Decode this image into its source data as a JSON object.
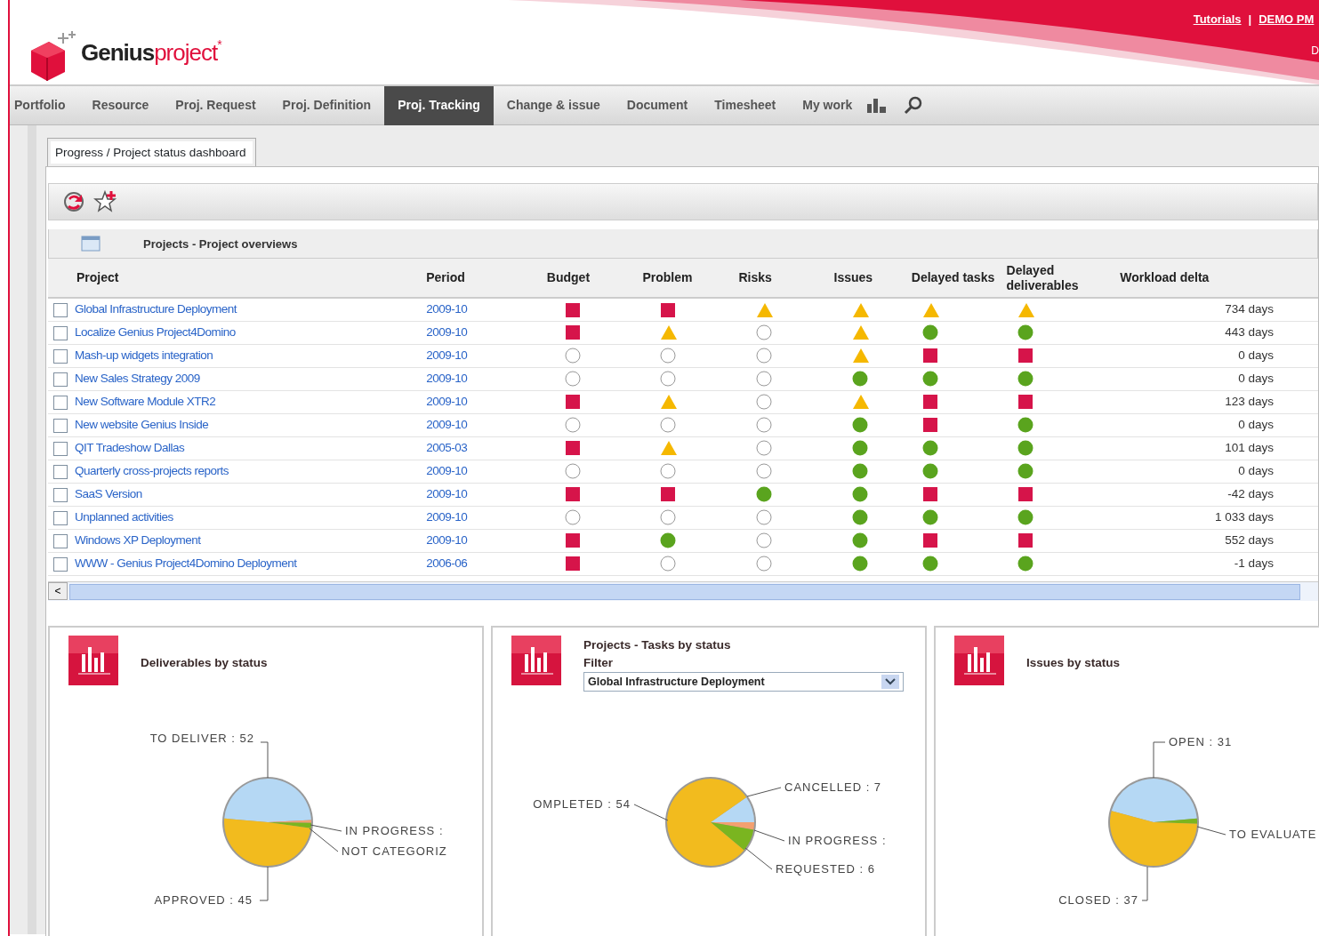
{
  "header": {
    "logo": {
      "brand": "Genius",
      "product": "project",
      "mark": "*"
    },
    "links": [
      {
        "label": "Tutorials"
      },
      {
        "label": "DEMO PM"
      }
    ],
    "separator": "|",
    "user_initial": "D"
  },
  "nav": [
    {
      "label": "Portfolio",
      "selected": false
    },
    {
      "label": "Resource",
      "selected": false
    },
    {
      "label": "Proj. Request",
      "selected": false
    },
    {
      "label": "Proj. Definition",
      "selected": false
    },
    {
      "label": "Proj. Tracking",
      "selected": true
    },
    {
      "label": "Change & issue",
      "selected": false
    },
    {
      "label": "Document",
      "selected": false
    },
    {
      "label": "Timesheet",
      "selected": false
    },
    {
      "label": "My work",
      "selected": false
    }
  ],
  "page_tab": {
    "label": "Progress / Project status dashboard",
    "selected": true
  },
  "panel": {
    "title": "Projects - Project overviews",
    "table": {
      "columns": [
        "Project",
        "Period",
        "Budget",
        "Problem",
        "Risks",
        "Issues",
        "Delayed tasks",
        "Delayed deliverables",
        "Workload delta"
      ],
      "rows": [
        {
          "project": "Global Infrastructure Deployment",
          "period": "2009-10",
          "checked": false,
          "statuses": [
            {
              "kind": "late"
            },
            {
              "kind": "late"
            },
            {
              "kind": "warning"
            },
            {
              "kind": "warning"
            },
            {
              "kind": "warning"
            },
            {
              "kind": "warning"
            }
          ],
          "workload": "734 days"
        },
        {
          "project": "Localize Genius Project4Domino",
          "period": "2009-10",
          "checked": false,
          "statuses": [
            {
              "kind": "late"
            },
            {
              "kind": "warning"
            },
            {
              "kind": "none"
            },
            {
              "kind": "warning"
            },
            {
              "kind": "ok"
            },
            {
              "kind": "ok"
            }
          ],
          "workload": "443 days"
        },
        {
          "project": "Mash-up widgets integration",
          "period": "2009-10",
          "checked": false,
          "statuses": [
            {
              "kind": "none"
            },
            {
              "kind": "none"
            },
            {
              "kind": "none"
            },
            {
              "kind": "warning"
            },
            {
              "kind": "late"
            },
            {
              "kind": "late"
            }
          ],
          "workload": "0 days"
        },
        {
          "project": "New Sales Strategy 2009",
          "period": "2009-10",
          "checked": false,
          "statuses": [
            {
              "kind": "none"
            },
            {
              "kind": "none"
            },
            {
              "kind": "none"
            },
            {
              "kind": "ok"
            },
            {
              "kind": "ok"
            },
            {
              "kind": "ok"
            }
          ],
          "workload": "0 days"
        },
        {
          "project": "New Software Module XTR2",
          "period": "2009-10",
          "checked": false,
          "statuses": [
            {
              "kind": "late"
            },
            {
              "kind": "warning"
            },
            {
              "kind": "none"
            },
            {
              "kind": "warning"
            },
            {
              "kind": "late"
            },
            {
              "kind": "late"
            }
          ],
          "workload": "123 days"
        },
        {
          "project": "New website Genius Inside",
          "period": "2009-10",
          "checked": false,
          "statuses": [
            {
              "kind": "none"
            },
            {
              "kind": "none"
            },
            {
              "kind": "none"
            },
            {
              "kind": "ok"
            },
            {
              "kind": "late"
            },
            {
              "kind": "ok"
            }
          ],
          "workload": "0 days"
        },
        {
          "project": "QIT Tradeshow Dallas",
          "period": "2005-03",
          "checked": false,
          "statuses": [
            {
              "kind": "late"
            },
            {
              "kind": "warning"
            },
            {
              "kind": "none"
            },
            {
              "kind": "ok"
            },
            {
              "kind": "ok"
            },
            {
              "kind": "ok"
            }
          ],
          "workload": "101 days"
        },
        {
          "project": "Quarterly cross-projects reports",
          "period": "2009-10",
          "checked": false,
          "statuses": [
            {
              "kind": "none"
            },
            {
              "kind": "none"
            },
            {
              "kind": "none"
            },
            {
              "kind": "ok"
            },
            {
              "kind": "ok"
            },
            {
              "kind": "ok"
            }
          ],
          "workload": "0 days"
        },
        {
          "project": "SaaS Version",
          "period": "2009-10",
          "checked": false,
          "statuses": [
            {
              "kind": "late"
            },
            {
              "kind": "late"
            },
            {
              "kind": "ok"
            },
            {
              "kind": "ok"
            },
            {
              "kind": "late"
            },
            {
              "kind": "late"
            }
          ],
          "workload": "-42 days"
        },
        {
          "project": "Unplanned activities",
          "period": "2009-10",
          "checked": false,
          "statuses": [
            {
              "kind": "none"
            },
            {
              "kind": "none"
            },
            {
              "kind": "none"
            },
            {
              "kind": "ok"
            },
            {
              "kind": "ok"
            },
            {
              "kind": "ok"
            }
          ],
          "workload": "1 033 days"
        },
        {
          "project": "Windows XP Deployment",
          "period": "2009-10",
          "checked": false,
          "statuses": [
            {
              "kind": "late"
            },
            {
              "kind": "ok"
            },
            {
              "kind": "none"
            },
            {
              "kind": "ok"
            },
            {
              "kind": "late"
            },
            {
              "kind": "late"
            }
          ],
          "workload": "552 days"
        },
        {
          "project": "WWW - Genius Project4Domino Deployment",
          "period": "2006-06",
          "checked": false,
          "statuses": [
            {
              "kind": "late"
            },
            {
              "kind": "none"
            },
            {
              "kind": "none"
            },
            {
              "kind": "ok"
            },
            {
              "kind": "ok"
            },
            {
              "kind": "ok"
            }
          ],
          "workload": "-1 days"
        }
      ]
    }
  },
  "scroll": {
    "left_glyph": "<"
  },
  "charts": [
    {
      "title": "Deliverables by status",
      "labels": [
        "TO DELIVER : 52",
        "IN PROGRESS :",
        "NOT CATEGORIZ",
        "APPROVED : 45"
      ]
    },
    {
      "title": "Projects - Tasks by status",
      "filter": {
        "label": "Filter",
        "value": "Global Infrastructure Deployment"
      },
      "labels": [
        "OMPLETED : 54",
        "CANCELLED : 7",
        "IN PROGRESS :",
        "REQUESTED : 6"
      ]
    },
    {
      "title": "Issues by status",
      "labels": [
        "OPEN : 31",
        "TO EVALUATE",
        "CLOSED : 37"
      ]
    }
  ]
}
